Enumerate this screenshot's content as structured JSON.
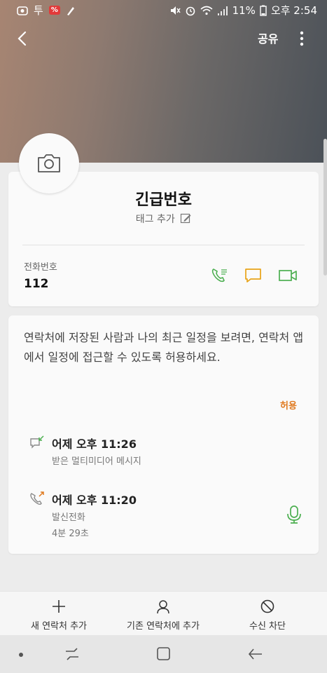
{
  "status": {
    "carrier": "투",
    "badge": "%",
    "battery": "11%",
    "time": "오후 2:54"
  },
  "topbar": {
    "share_label": "공유"
  },
  "contact": {
    "name": "긴급번호",
    "tag_label": "태그 추가",
    "phone_label": "전화번호",
    "phone_number": "112"
  },
  "permission": {
    "message": "연락처에 저장된 사람과 나의 최근 일정을 보려면, 연락처 앱에서 일정에 접근할 수 있도록 허용하세요.",
    "allow_label": "허용"
  },
  "logs": [
    {
      "title": "어제 오후 11:26",
      "subtitle": "받은 멀티미디어 메시지",
      "icon": "incoming-message-icon"
    },
    {
      "title": "어제 오후 11:20",
      "subtitle": "발신전화",
      "duration": "4분 29초",
      "icon": "outgoing-call-icon"
    }
  ],
  "bottom_actions": [
    {
      "label": "새 연락처 추가",
      "icon": "plus-icon"
    },
    {
      "label": "기존 연락처에 추가",
      "icon": "person-icon"
    },
    {
      "label": "수신 차단",
      "icon": "block-icon"
    }
  ],
  "colors": {
    "call": "#4caf50",
    "message": "#e8a317",
    "video": "#4caf50",
    "allow": "#e07a1f"
  }
}
